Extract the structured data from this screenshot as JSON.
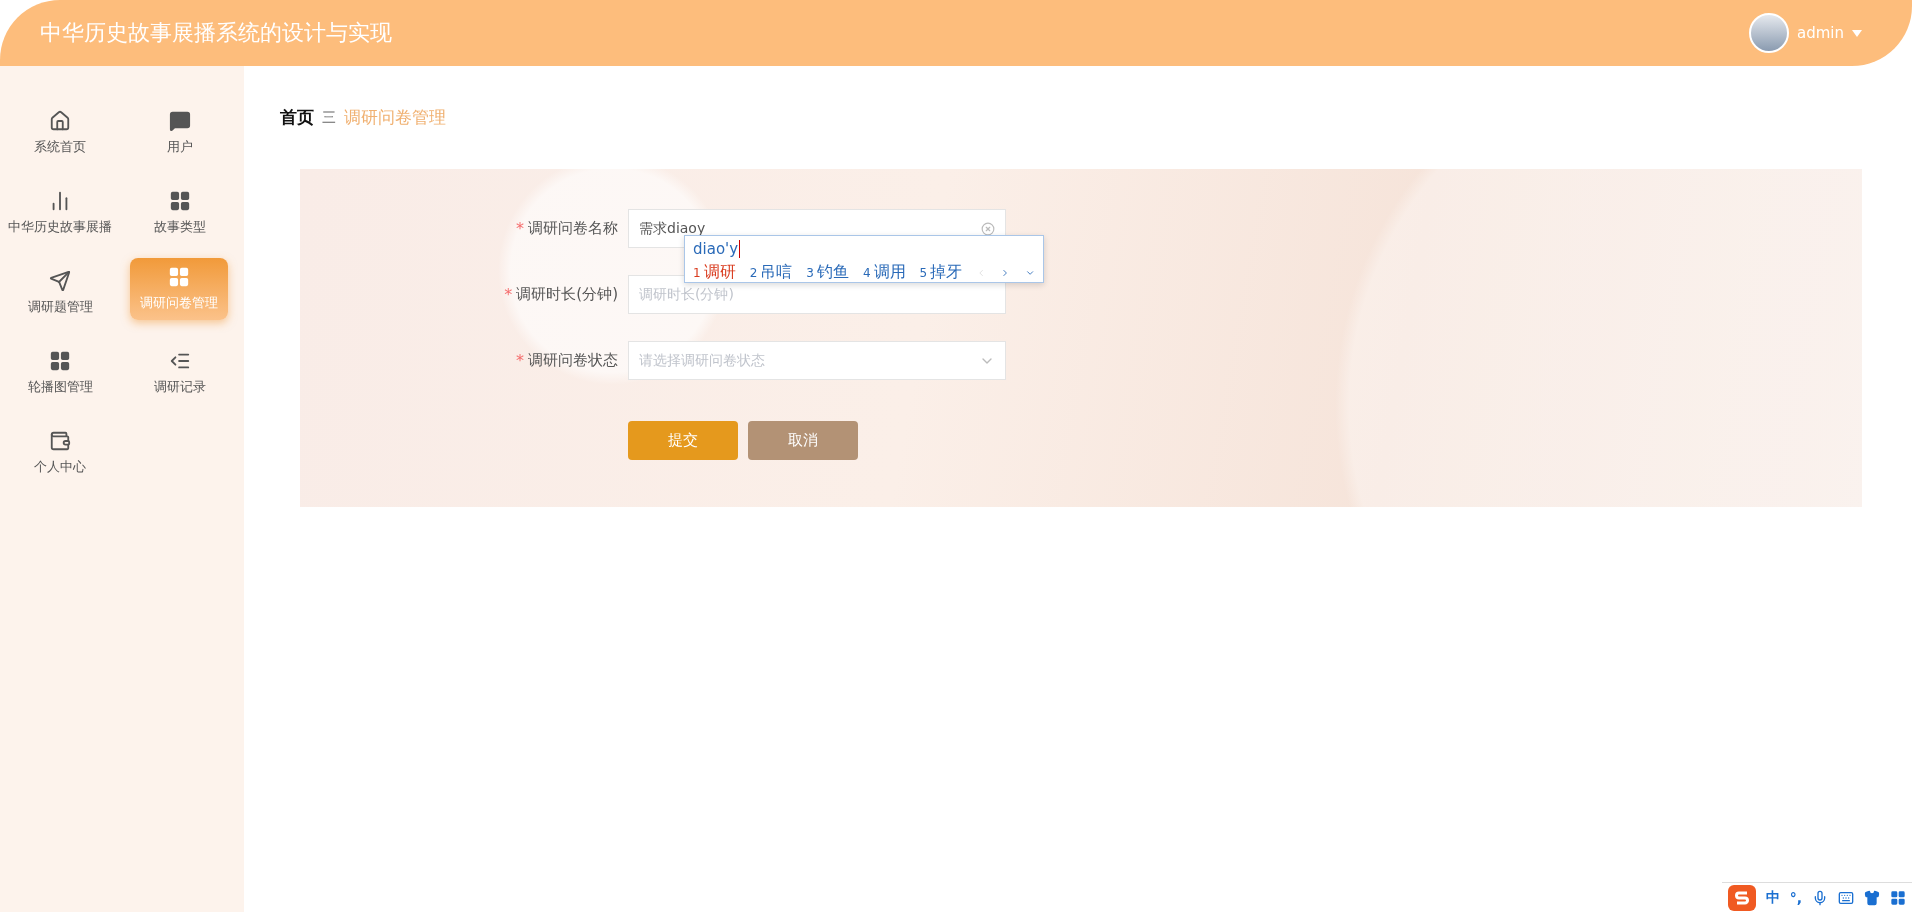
{
  "header": {
    "title": "中华历史故事展播系统的设计与实现",
    "user": {
      "name": "admin"
    }
  },
  "sidebar": {
    "items": [
      {
        "label": "系统首页",
        "selected": false
      },
      {
        "label": "用户",
        "selected": false
      },
      {
        "label": "中华历史故事展播",
        "selected": false
      },
      {
        "label": "故事类型",
        "selected": false
      },
      {
        "label": "调研题管理",
        "selected": false
      },
      {
        "label": "调研问卷管理",
        "selected": true
      },
      {
        "label": "轮播图管理",
        "selected": false
      },
      {
        "label": "调研记录",
        "selected": false
      },
      {
        "label": "个人中心",
        "selected": false
      }
    ]
  },
  "breadcrumb": {
    "items": [
      "首页",
      "调研问卷管理"
    ],
    "separator": "三"
  },
  "form": {
    "fields": [
      {
        "kind": "input",
        "required_mark": "*",
        "label": "调研问卷名称",
        "value": "需求diaoy",
        "clearable": true
      },
      {
        "kind": "input",
        "required_mark": "*",
        "label": "调研时长(分钟)",
        "placeholder": "调研时长(分钟)"
      },
      {
        "kind": "select",
        "required_mark": "*",
        "label": "调研问卷状态",
        "placeholder": "请选择调研问卷状态"
      }
    ],
    "buttons": [
      {
        "kind": "primary",
        "label": "提交"
      },
      {
        "kind": "secondary",
        "label": "取消"
      }
    ]
  },
  "ime": {
    "composition": "diao'y",
    "candidates": [
      {
        "index": "1",
        "text": "调研",
        "selected": true
      },
      {
        "index": "2",
        "text": "吊唁",
        "selected": false
      },
      {
        "index": "3",
        "text": "钓鱼",
        "selected": false
      },
      {
        "index": "4",
        "text": "调用",
        "selected": false
      },
      {
        "index": "5",
        "text": "掉牙",
        "selected": false
      }
    ]
  },
  "tray": {
    "mode": "中",
    "punctuation": "°,"
  }
}
